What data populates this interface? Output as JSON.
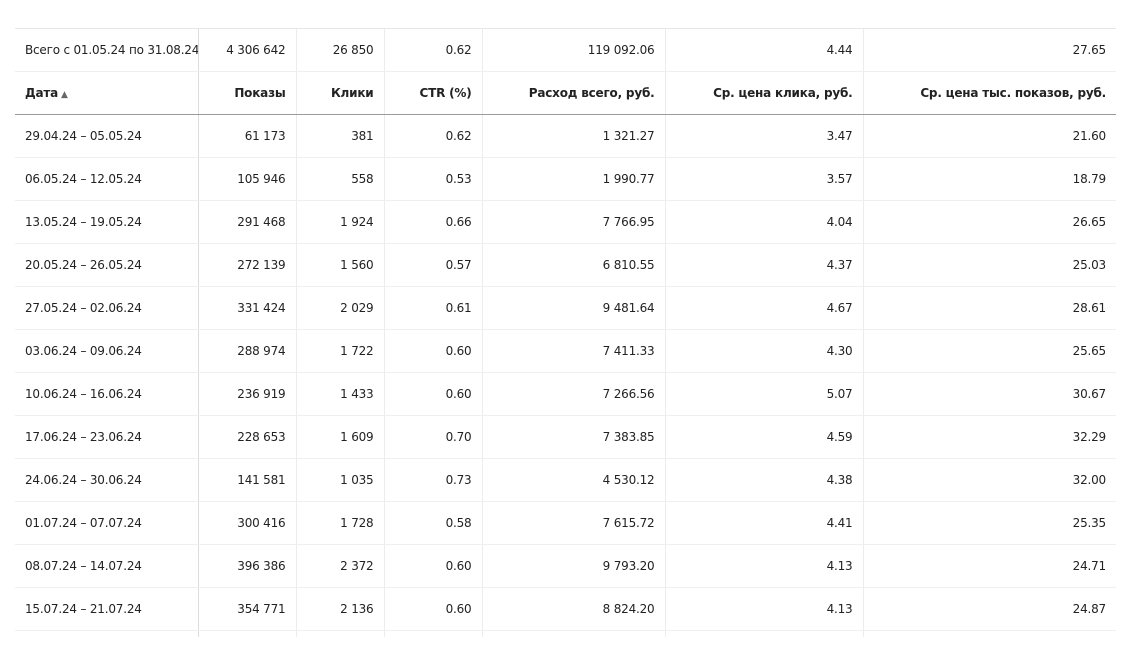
{
  "totals": {
    "label": "Всего с 01.05.24 по 31.08.24",
    "impressions": "4 306 642",
    "clicks": "26 850",
    "ctr": "0.62",
    "spend": "119 092.06",
    "cpc": "4.44",
    "cpm": "27.65"
  },
  "columns": {
    "date": "Дата",
    "date_sort_icon": "▲",
    "impressions": "Показы",
    "clicks": "Клики",
    "ctr": "CTR (%)",
    "spend": "Расход всего, руб.",
    "cpc": "Ср. цена клика, руб.",
    "cpm": "Ср. цена тыс. показов, руб."
  },
  "rows": [
    {
      "date": "29.04.24 – 05.05.24",
      "impressions": "61 173",
      "clicks": "381",
      "ctr": "0.62",
      "spend": "1 321.27",
      "cpc": "3.47",
      "cpm": "21.60"
    },
    {
      "date": "06.05.24 – 12.05.24",
      "impressions": "105 946",
      "clicks": "558",
      "ctr": "0.53",
      "spend": "1 990.77",
      "cpc": "3.57",
      "cpm": "18.79"
    },
    {
      "date": "13.05.24 – 19.05.24",
      "impressions": "291 468",
      "clicks": "1 924",
      "ctr": "0.66",
      "spend": "7 766.95",
      "cpc": "4.04",
      "cpm": "26.65"
    },
    {
      "date": "20.05.24 – 26.05.24",
      "impressions": "272 139",
      "clicks": "1 560",
      "ctr": "0.57",
      "spend": "6 810.55",
      "cpc": "4.37",
      "cpm": "25.03"
    },
    {
      "date": "27.05.24 – 02.06.24",
      "impressions": "331 424",
      "clicks": "2 029",
      "ctr": "0.61",
      "spend": "9 481.64",
      "cpc": "4.67",
      "cpm": "28.61"
    },
    {
      "date": "03.06.24 – 09.06.24",
      "impressions": "288 974",
      "clicks": "1 722",
      "ctr": "0.60",
      "spend": "7 411.33",
      "cpc": "4.30",
      "cpm": "25.65"
    },
    {
      "date": "10.06.24 – 16.06.24",
      "impressions": "236 919",
      "clicks": "1 433",
      "ctr": "0.60",
      "spend": "7 266.56",
      "cpc": "5.07",
      "cpm": "30.67"
    },
    {
      "date": "17.06.24 – 23.06.24",
      "impressions": "228 653",
      "clicks": "1 609",
      "ctr": "0.70",
      "spend": "7 383.85",
      "cpc": "4.59",
      "cpm": "32.29"
    },
    {
      "date": "24.06.24 – 30.06.24",
      "impressions": "141 581",
      "clicks": "1 035",
      "ctr": "0.73",
      "spend": "4 530.12",
      "cpc": "4.38",
      "cpm": "32.00"
    },
    {
      "date": "01.07.24 – 07.07.24",
      "impressions": "300 416",
      "clicks": "1 728",
      "ctr": "0.58",
      "spend": "7 615.72",
      "cpc": "4.41",
      "cpm": "25.35"
    },
    {
      "date": "08.07.24 – 14.07.24",
      "impressions": "396 386",
      "clicks": "2 372",
      "ctr": "0.60",
      "spend": "9 793.20",
      "cpc": "4.13",
      "cpm": "24.71"
    },
    {
      "date": "15.07.24 – 21.07.24",
      "impressions": "354 771",
      "clicks": "2 136",
      "ctr": "0.60",
      "spend": "8 824.20",
      "cpc": "4.13",
      "cpm": "24.87"
    },
    {
      "date": "",
      "impressions": "",
      "clicks": "",
      "ctr": "",
      "spend": "",
      "cpc": "",
      "cpm": ""
    }
  ]
}
